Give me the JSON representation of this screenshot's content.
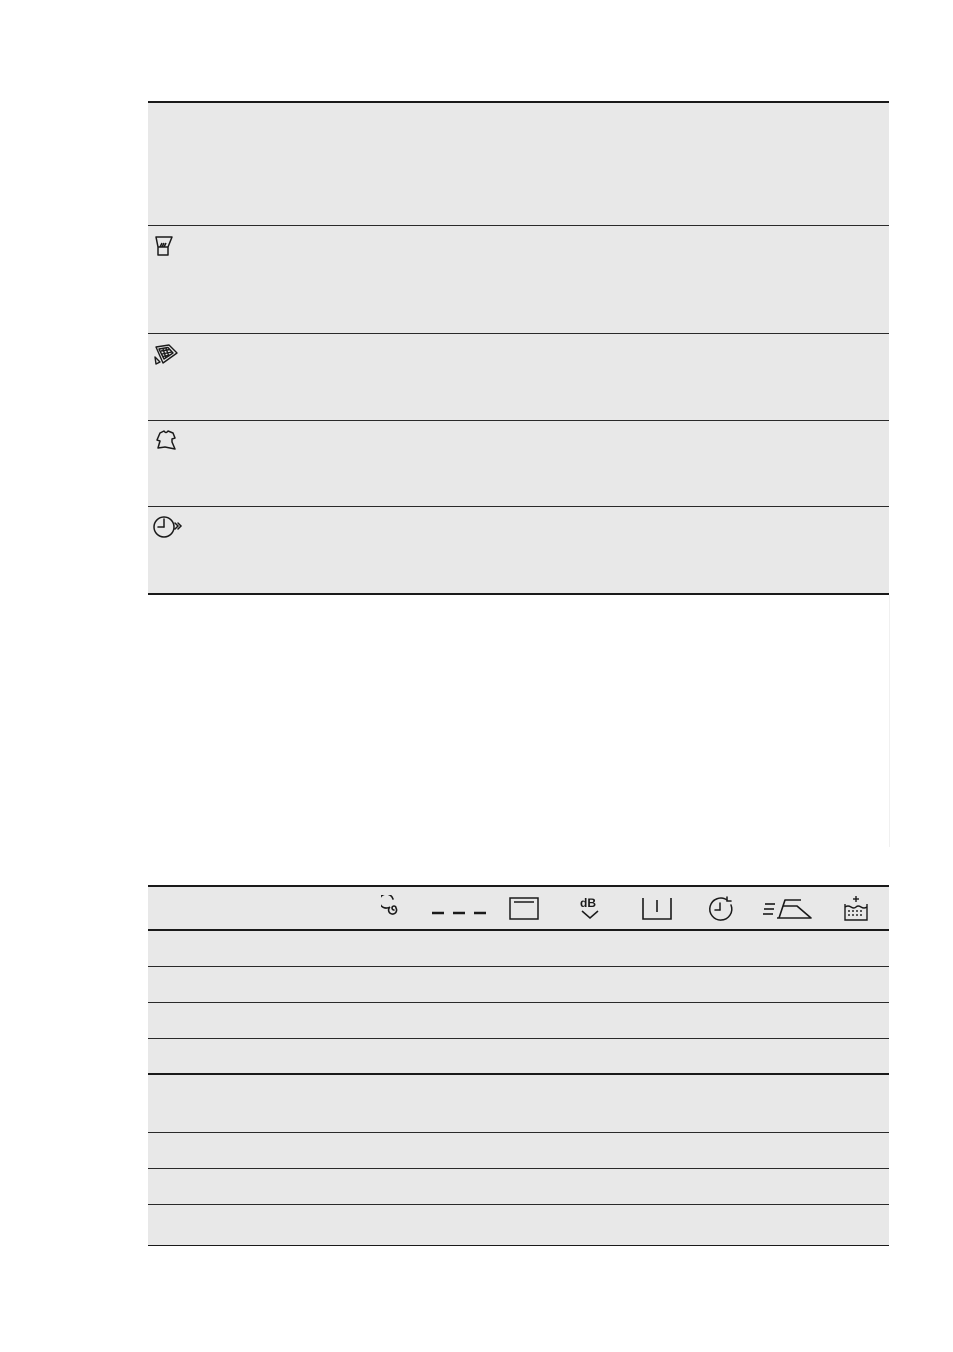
{
  "options_table": {
    "rows": [
      {
        "icon": "none",
        "label": ""
      },
      {
        "icon": "prewash-icon",
        "label": ""
      },
      {
        "icon": "stain-icon",
        "label": ""
      },
      {
        "icon": "extra-rinse-icon",
        "label": ""
      },
      {
        "icon": "delay-start-icon",
        "label": ""
      }
    ]
  },
  "programme_table": {
    "header_icons": [
      "spin-icon",
      "no-spin-icon",
      "rinse-hold-icon",
      "night-cycle-icon",
      "prewash-tub-icon",
      "time-save-icon",
      "easy-iron-icon",
      "extra-rinse-tub-icon"
    ],
    "row_count": 8
  }
}
